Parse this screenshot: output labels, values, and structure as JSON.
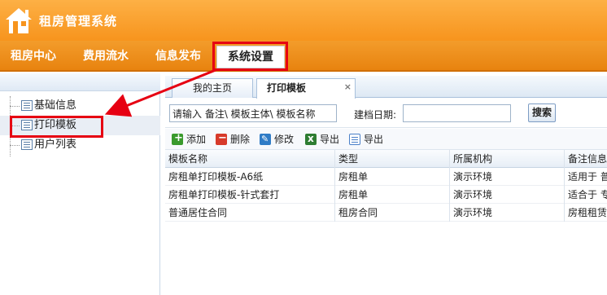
{
  "app": {
    "title": "租房管理系统",
    "logo_icon": "house-icon"
  },
  "nav": {
    "items": [
      {
        "label": "租房中心"
      },
      {
        "label": "费用流水"
      },
      {
        "label": "信息发布"
      },
      {
        "label": "系统设置",
        "active": true
      }
    ]
  },
  "sidebar": {
    "items": [
      {
        "label": "基础信息"
      },
      {
        "label": "打印模板",
        "selected": true
      },
      {
        "label": "用户列表"
      }
    ]
  },
  "tabs": [
    {
      "label": "我的主页"
    },
    {
      "label": "打印模板",
      "active": true,
      "close": "×"
    }
  ],
  "search": {
    "value": "请输入 备注\\ 模板主体\\ 模板名称",
    "date_label": "建档日期:",
    "date_value": "",
    "button_label": "搜索"
  },
  "toolbar": {
    "add": "添加",
    "delete": "删除",
    "edit": "修改",
    "export_excel": "导出",
    "export_doc": "导出"
  },
  "table": {
    "columns": [
      "模板名称",
      "类型",
      "所属机构",
      "备注信息"
    ],
    "rows": [
      [
        "房租单打印模板-A6纸",
        "房租单",
        "演示环境",
        "适用于 普"
      ],
      [
        "房租单打印模板-针式套打",
        "房租单",
        "演示环境",
        "适合于 专"
      ],
      [
        "普通居住合同",
        "租房合同",
        "演示环境",
        "房租租赁"
      ]
    ]
  },
  "annotation": {
    "highlight_color": "#e60012"
  }
}
